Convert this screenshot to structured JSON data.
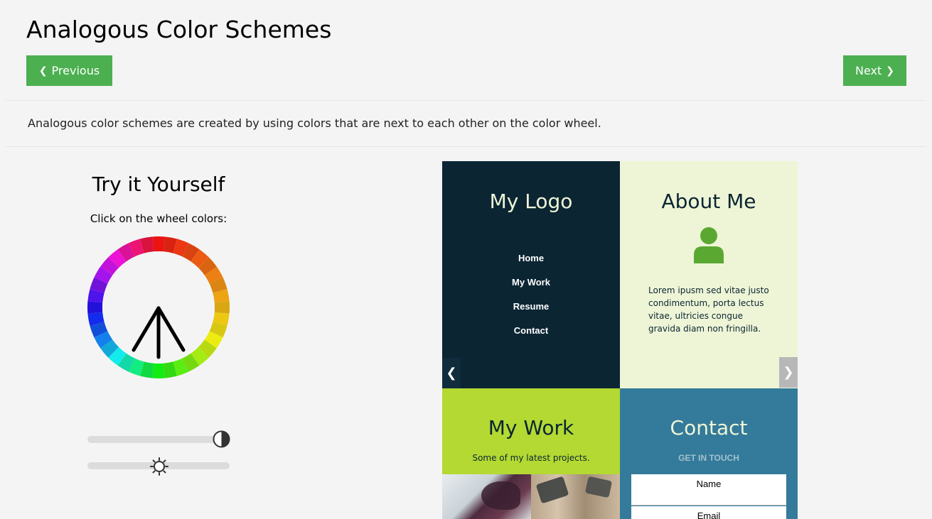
{
  "page": {
    "title": "Analogous Color Schemes",
    "prev_label": "Previous",
    "next_label": "Next",
    "intro": "Analogous color schemes are created by using colors that are next to each other on the color wheel."
  },
  "tool": {
    "title": "Try it Yourself",
    "subtitle": "Click on the wheel colors:",
    "contrast_value": 1.0,
    "brightness_value": 0.5
  },
  "colors": {
    "accent": "#4caf50",
    "logo_bg": "#0b2533",
    "about_bg": "#eef5d6",
    "work_bg": "#b3d932",
    "contact_bg": "#347a9a",
    "icon_green": "#5aa832"
  },
  "preview": {
    "logo": {
      "title": "My Logo",
      "menu": [
        "Home",
        "My Work",
        "Resume",
        "Contact"
      ]
    },
    "about": {
      "title": "About Me",
      "text": "Lorem ipusm sed vitae justo condimentum, porta lectus vitae, ultricies congue gravida diam non fringilla."
    },
    "work": {
      "title": "My Work",
      "subtitle": "Some of my latest projects."
    },
    "contact": {
      "title": "Contact",
      "subtitle": "GET IN TOUCH",
      "name_placeholder": "Name",
      "email_placeholder": "Email"
    },
    "arrows": {
      "left": "❮",
      "right": "❯"
    }
  },
  "icons": {
    "prev": "chevron-left-icon",
    "next": "chevron-right-icon",
    "wheel_pointer": "arrow-up-icon",
    "contrast": "contrast-icon",
    "brightness": "sun-icon",
    "user": "user-icon"
  }
}
